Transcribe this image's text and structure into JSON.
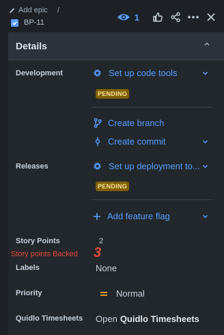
{
  "header": {
    "add_epic": "Add epic",
    "separator": "/",
    "issue_key": "BP-11",
    "watchers_count": "1"
  },
  "details": {
    "title": "Details",
    "development": {
      "label": "Development",
      "setup_code_tools": "Set up code tools",
      "status_1": "PENDING",
      "create_branch": "Create branch",
      "create_commit": "Create commit"
    },
    "releases": {
      "label": "Releases",
      "setup_deployment": "Set up deployment to...",
      "status_2": "PENDING",
      "add_feature_flag": "Add feature flag"
    },
    "story_points": {
      "label": "Story Points",
      "value": "2"
    },
    "annotation": {
      "text": "Story points Backed",
      "big_number": "3"
    },
    "labels": {
      "label": "Labels",
      "value": "None"
    },
    "priority": {
      "label": "Priority",
      "value": "Normal"
    },
    "quidlo": {
      "label": "Quidlo Timesheets",
      "prefix": "Open",
      "link": "Quidlo Timesheets"
    }
  },
  "colors": {
    "background": "#1d2125",
    "panel": "#22272b",
    "link": "#579dff",
    "pending_badge": "#7f5f01",
    "annotation_red": "#e2483d",
    "priority_orange": "#f5a623"
  }
}
